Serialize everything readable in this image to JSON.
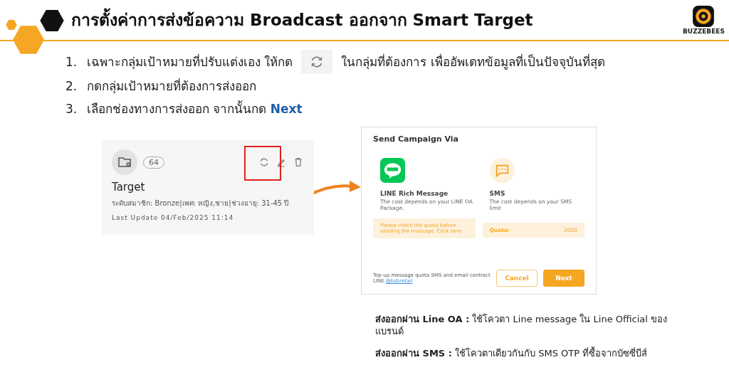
{
  "header": {
    "title": "การตั้งค่าการส่งข้อความ Broadcast ออกจาก Smart Target",
    "logo_text": "BUZZEBEES"
  },
  "steps": [
    {
      "number": "1.",
      "kind": "icon",
      "text": "เฉพาะกลุ่มเป้าหมายที่ปรับแต่งเอง ให้กด",
      "text_after": "ในกลุ่มที่ต้องการ เพื่ออัพเดทข้อมูลที่เป็นปัจจุบันที่สุด"
    },
    {
      "number": "2.",
      "kind": "plain",
      "text": "กดกลุ่มเป้าหมายที่ต้องการส่งออก"
    },
    {
      "number": "3.",
      "kind": "plain",
      "text": "เลือกช่องทางการส่งออก จากนั้นกด **Next**"
    }
  ],
  "target_card": {
    "badge": "64",
    "title": "Target",
    "details": "ระดับสมาชิก: Bronze|เพศ: หญิง,ชาย|ช่วงอายุ: 31-45 ปี",
    "last_update_label": "Last Update",
    "last_update": "04/Feb/2025 11:14",
    "refresh_highlighted": true
  },
  "dialog": {
    "title": "Send Campaign Via",
    "options": [
      {
        "kind": "line",
        "title": "LINE Rich Message",
        "description": "The cost depends on your LINE OA Package.",
        "notice": "Please check the quota before sending the message. Click here"
      },
      {
        "kind": "sms",
        "title": "SMS",
        "description": "The cost depends on your SMS limit",
        "quota_label": "Quota:",
        "quota_value": "2000"
      }
    ],
    "footer_text": "Top-up message quota SMS and email contract LINE",
    "footer_link": "@bzbretail",
    "buttons": [
      {
        "kind": "secondary",
        "label": "Cancel"
      },
      {
        "kind": "primary",
        "label": "Next"
      }
    ]
  },
  "notes": [
    "**ส่งออกผ่าน Line OA :** ใช้โควตา Line message ใน Line Official ของแบรนด์",
    "**ส่งออกผ่าน SMS :** ใช้โควตาเดียวกันกับ SMS OTP ที่ซื้อจากบัซซี่บีส์"
  ]
}
